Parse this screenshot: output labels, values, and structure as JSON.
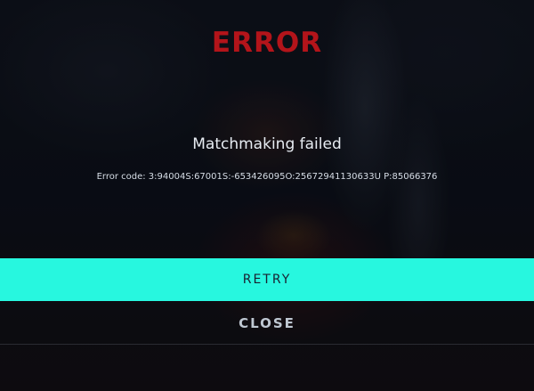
{
  "dialog": {
    "title": "ERROR",
    "message": "Matchmaking failed",
    "error_code_text": "Error code: 3:94004S:67001S:-653426095O:25672941130633U P:85066376"
  },
  "buttons": {
    "retry_label": "RETRY",
    "close_label": "CLOSE"
  },
  "colors": {
    "title": "#b3141a",
    "retry_background": "#27f7df",
    "retry_text": "#1a2030",
    "close_text": "#bfc8d2",
    "background": "#0b0e16"
  }
}
